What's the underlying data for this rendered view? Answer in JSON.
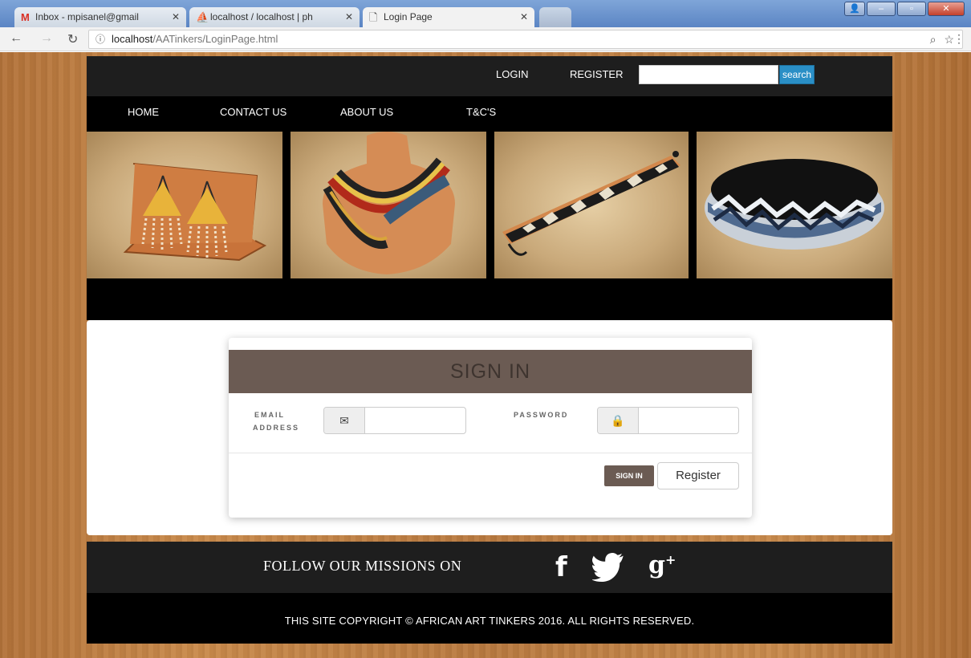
{
  "browser": {
    "tabs": [
      {
        "title": "Inbox - mpisanel@gmail",
        "icon": "gmail-icon"
      },
      {
        "title": "localhost / localhost | ph",
        "icon": "phpmyadmin-icon"
      },
      {
        "title": "Login Page",
        "icon": "page-icon"
      }
    ],
    "url_host": "localhost",
    "url_path": "/AATinkers/LoginPage.html",
    "tab_close": "✕"
  },
  "header": {
    "login": "LOGIN",
    "register": "REGISTER",
    "search_button": "search",
    "search_value": ""
  },
  "nav": {
    "items": [
      "HOME",
      "CONTACT US",
      "ABOUT US",
      "T&C'S"
    ]
  },
  "banner": {
    "photos": [
      "earrings",
      "necklace",
      "bracelet",
      "bangle"
    ]
  },
  "signin": {
    "title": "SIGN IN",
    "email_label_line1": "EMAIL",
    "email_label_line2": "ADDRESS",
    "password_label": "PASSWORD",
    "email_value": "",
    "password_value": "",
    "signin_button": "SIGN IN",
    "register_button": "Register"
  },
  "footer": {
    "follow_text": "FOLLOW OUR MISSIONS ON",
    "social": [
      {
        "name": "facebook-icon",
        "glyph": "f"
      },
      {
        "name": "twitter-icon",
        "glyph": "twitter"
      },
      {
        "name": "google-plus-icon",
        "glyph": "g+"
      }
    ],
    "copyright": "THIS SITE COPYRIGHT © AFRICAN ART TINKERS 2016. ALL RIGHTS RESERVED."
  },
  "colors": {
    "accent_brown": "#6b5b53",
    "search_blue": "#2a8fc6",
    "wood": "#c08244"
  }
}
